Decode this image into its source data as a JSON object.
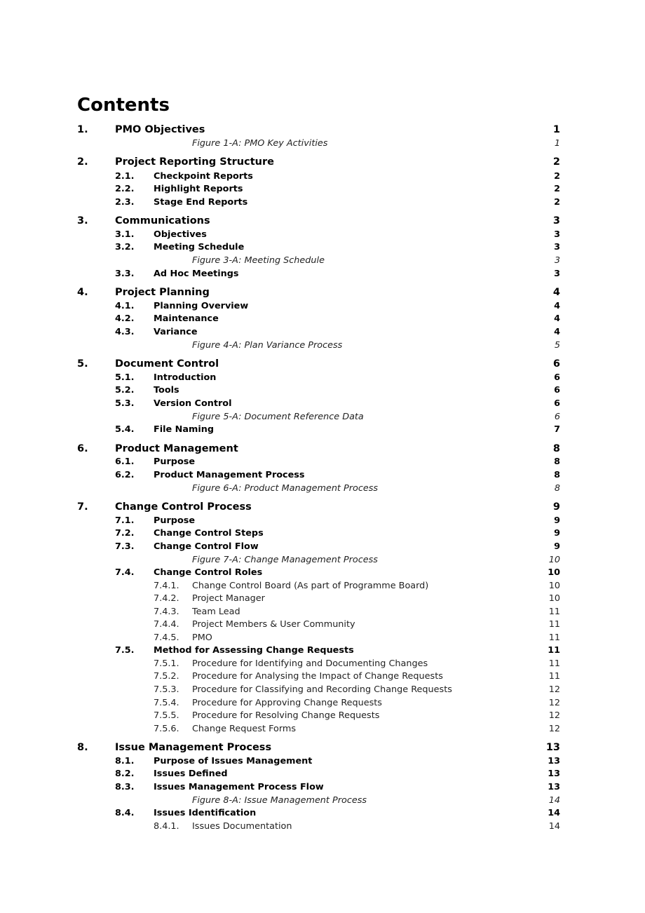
{
  "document": {
    "title": "Contents",
    "entries": [
      {
        "level": "l1",
        "num": "1.",
        "label": "PMO Objectives",
        "page": "1"
      },
      {
        "level": "fig",
        "num": "",
        "label": "Figure 1-A: PMO Key Activities",
        "page": "1"
      },
      {
        "level": "l1",
        "num": "2.",
        "label": "Project Reporting Structure",
        "page": "2"
      },
      {
        "level": "l2",
        "num": "2.1.",
        "label": "Checkpoint Reports",
        "page": "2"
      },
      {
        "level": "l2",
        "num": "2.2.",
        "label": "Highlight Reports",
        "page": "2"
      },
      {
        "level": "l2",
        "num": "2.3.",
        "label": "Stage End Reports",
        "page": "2"
      },
      {
        "level": "l1",
        "num": "3.",
        "label": "Communications",
        "page": "3"
      },
      {
        "level": "l2",
        "num": "3.1.",
        "label": "Objectives",
        "page": "3"
      },
      {
        "level": "l2",
        "num": "3.2.",
        "label": "Meeting Schedule",
        "page": "3"
      },
      {
        "level": "fig",
        "num": "",
        "label": "Figure 3-A: Meeting Schedule",
        "page": "3"
      },
      {
        "level": "l2",
        "num": "3.3.",
        "label": "Ad Hoc Meetings",
        "page": "3"
      },
      {
        "level": "l1",
        "num": "4.",
        "label": "Project Planning",
        "page": "4"
      },
      {
        "level": "l2",
        "num": "4.1.",
        "label": "Planning Overview",
        "page": "4"
      },
      {
        "level": "l2",
        "num": "4.2.",
        "label": "Maintenance",
        "page": "4"
      },
      {
        "level": "l2",
        "num": "4.3.",
        "label": "Variance",
        "page": "4"
      },
      {
        "level": "fig",
        "num": "",
        "label": "Figure 4-A: Plan Variance Process",
        "page": "5"
      },
      {
        "level": "l1",
        "num": "5.",
        "label": "Document Control",
        "page": "6"
      },
      {
        "level": "l2",
        "num": "5.1.",
        "label": "Introduction",
        "page": "6"
      },
      {
        "level": "l2",
        "num": "5.2.",
        "label": "Tools",
        "page": "6"
      },
      {
        "level": "l2",
        "num": "5.3.",
        "label": "Version Control",
        "page": "6"
      },
      {
        "level": "fig",
        "num": "",
        "label": "Figure 5-A: Document Reference Data",
        "page": "6"
      },
      {
        "level": "l2",
        "num": "5.4.",
        "label": "File Naming",
        "page": "7"
      },
      {
        "level": "l1",
        "num": "6.",
        "label": "Product Management",
        "page": "8"
      },
      {
        "level": "l2",
        "num": "6.1.",
        "label": "Purpose",
        "page": "8"
      },
      {
        "level": "l2",
        "num": "6.2.",
        "label": "Product Management Process",
        "page": "8"
      },
      {
        "level": "fig",
        "num": "",
        "label": "Figure 6-A: Product Management Process",
        "page": "8"
      },
      {
        "level": "l1",
        "num": "7.",
        "label": "Change Control Process",
        "page": "9"
      },
      {
        "level": "l2",
        "num": "7.1.",
        "label": "Purpose",
        "page": "9"
      },
      {
        "level": "l2",
        "num": "7.2.",
        "label": "Change Control Steps",
        "page": "9"
      },
      {
        "level": "l2",
        "num": "7.3.",
        "label": "Change Control Flow",
        "page": "9"
      },
      {
        "level": "fig",
        "num": "",
        "label": "Figure 7-A: Change Management Process",
        "page": "10"
      },
      {
        "level": "l2",
        "num": "7.4.",
        "label": "Change Control Roles",
        "page": "10"
      },
      {
        "level": "l3",
        "num": "7.4.1.",
        "label": "Change Control Board (As part of Programme Board)",
        "page": "10"
      },
      {
        "level": "l3",
        "num": "7.4.2.",
        "label": "Project Manager",
        "page": "10"
      },
      {
        "level": "l3",
        "num": "7.4.3.",
        "label": "Team Lead",
        "page": "11"
      },
      {
        "level": "l3",
        "num": "7.4.4.",
        "label": "Project Members & User Community",
        "page": "11"
      },
      {
        "level": "l3",
        "num": "7.4.5.",
        "label": "PMO",
        "page": "11"
      },
      {
        "level": "l2",
        "num": "7.5.",
        "label": "Method for Assessing Change Requests",
        "page": "11"
      },
      {
        "level": "l3",
        "num": "7.5.1.",
        "label": "Procedure for Identifying and Documenting Changes",
        "page": "11"
      },
      {
        "level": "l3",
        "num": "7.5.2.",
        "label": "Procedure for Analysing the Impact of Change Requests",
        "page": "11"
      },
      {
        "level": "l3",
        "num": "7.5.3.",
        "label": "Procedure for Classifying and Recording Change Requests",
        "page": "12"
      },
      {
        "level": "l3",
        "num": "7.5.4.",
        "label": "Procedure for Approving Change Requests",
        "page": "12"
      },
      {
        "level": "l3",
        "num": "7.5.5.",
        "label": "Procedure for Resolving Change Requests",
        "page": "12"
      },
      {
        "level": "l3",
        "num": "7.5.6.",
        "label": "Change Request Forms",
        "page": "12"
      },
      {
        "level": "l1",
        "num": "8.",
        "label": "Issue Management Process",
        "page": "13"
      },
      {
        "level": "l2",
        "num": "8.1.",
        "label": "Purpose of Issues Management",
        "page": "13"
      },
      {
        "level": "l2",
        "num": "8.2.",
        "label": "Issues Defined",
        "page": "13"
      },
      {
        "level": "l2",
        "num": "8.3.",
        "label": "Issues Management Process Flow",
        "page": "13"
      },
      {
        "level": "fig",
        "num": "",
        "label": "Figure 8-A: Issue Management Process",
        "page": "14"
      },
      {
        "level": "l2",
        "num": "8.4.",
        "label": "Issues Identification",
        "page": "14"
      },
      {
        "level": "l3",
        "num": "8.4.1.",
        "label": "Issues Documentation",
        "page": "14"
      }
    ]
  }
}
